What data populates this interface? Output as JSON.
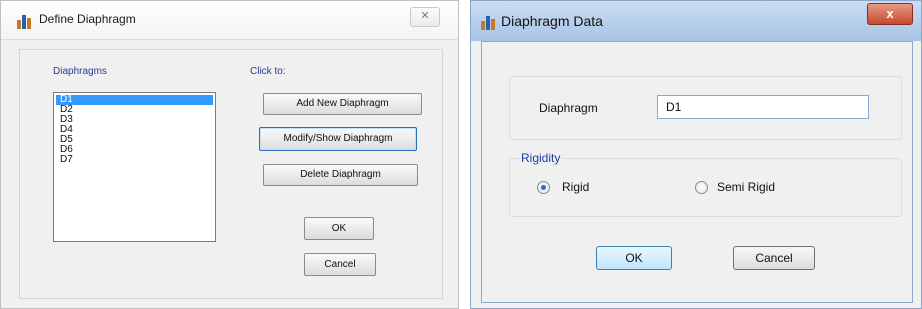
{
  "define_dialog": {
    "title": "Define Diaphragm",
    "close_label": "✕",
    "diaphragms_label": "Diaphragms",
    "click_to_label": "Click to:",
    "items": [
      "D1",
      "D2",
      "D3",
      "D4",
      "D5",
      "D6",
      "D7"
    ],
    "selected": "D1",
    "buttons": {
      "add": "Add New Diaphragm",
      "modify": "Modify/Show Diaphragm",
      "delete": "Delete Diaphragm",
      "ok": "OK",
      "cancel": "Cancel"
    }
  },
  "data_dialog": {
    "title": "Diaphragm Data",
    "close_label": "x",
    "diaphragm_label": "Diaphragm",
    "diaphragm_value": "D1",
    "rigidity_label": "Rigidity",
    "options": [
      "Rigid",
      "Semi Rigid"
    ],
    "selected_option": "Rigid",
    "buttons": {
      "ok": "OK",
      "cancel": "Cancel"
    }
  },
  "colors": {
    "selection": "#3399ff",
    "group_title": "#1b3faa",
    "label_blue": "#2b3a8f",
    "close_red": "#c44a2e"
  }
}
